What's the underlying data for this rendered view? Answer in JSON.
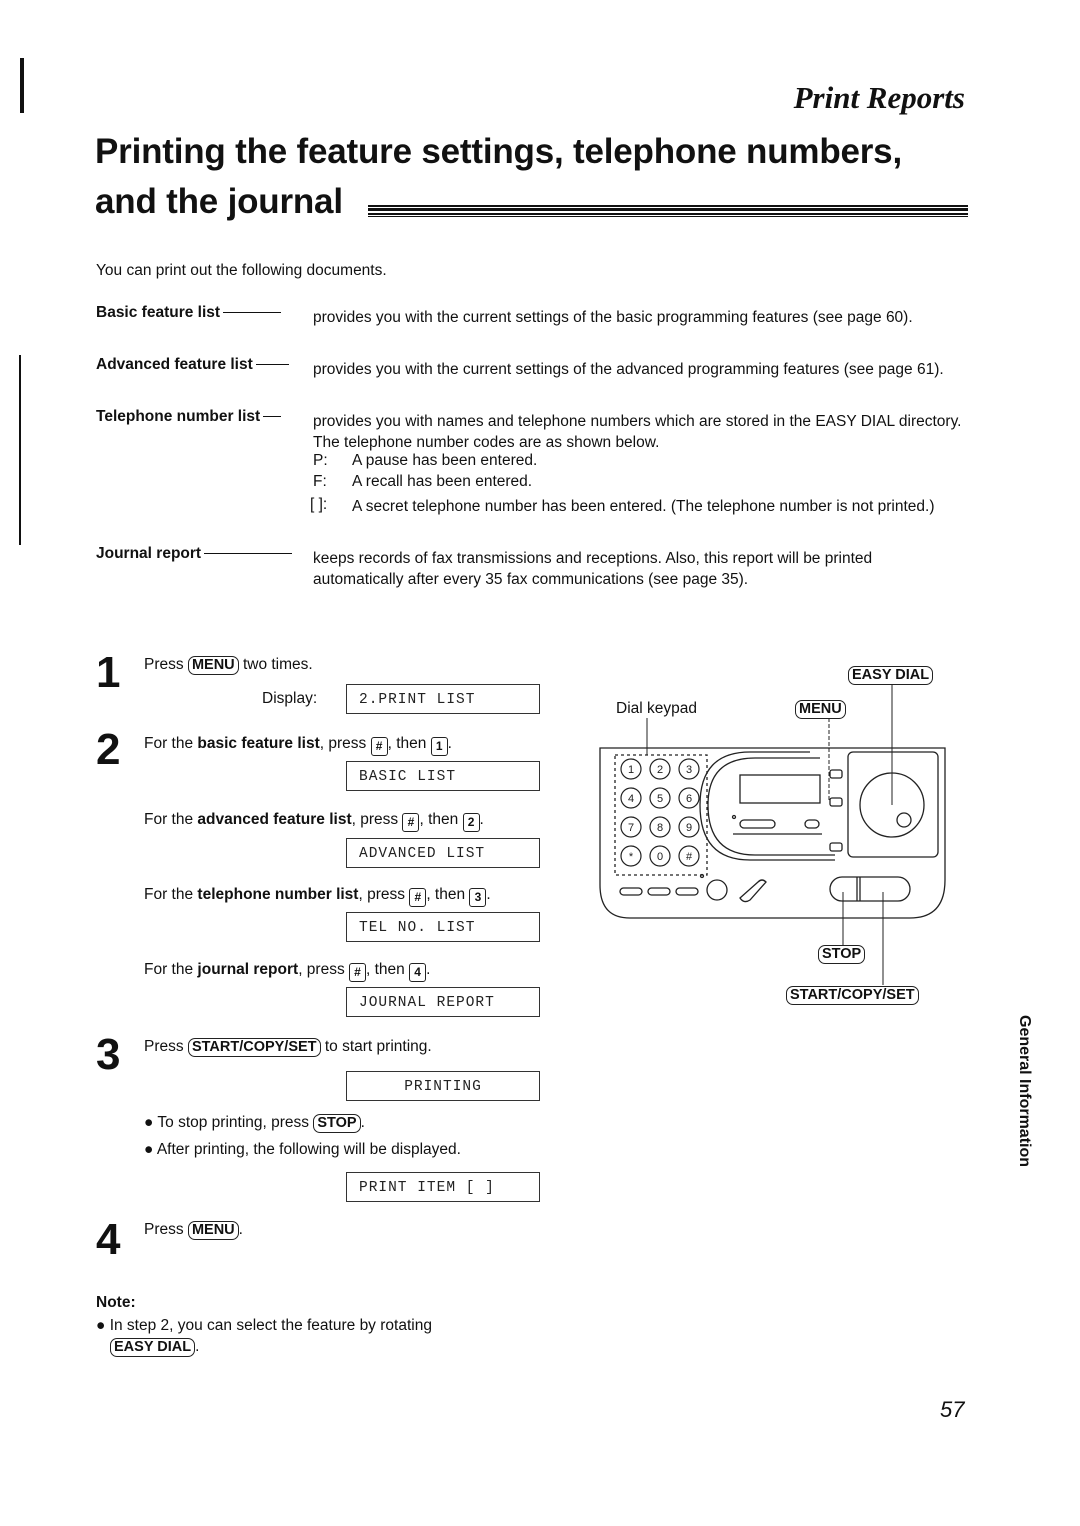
{
  "header": {
    "section_title": "Print Reports"
  },
  "title": {
    "line1": "Printing the feature settings, telephone numbers,",
    "line2": "and the journal"
  },
  "intro": "You can print out the following documents.",
  "definitions": [
    {
      "term": "Basic feature list",
      "desc": "provides you with the current settings of the basic programming features (see page 60)."
    },
    {
      "term": "Advanced feature list",
      "desc": "provides you with the current settings of the advanced programming features (see page 61)."
    },
    {
      "term": "Telephone number list",
      "desc": "provides you with names and telephone numbers which are stored in the EASY DIAL directory. The telephone number codes are as shown below."
    },
    {
      "term": "Journal report",
      "desc": "keeps records of fax transmissions and receptions. Also, this report will be printed automatically after every 35 fax communications (see page 35)."
    }
  ],
  "codes": [
    {
      "code": "P:",
      "desc": "A pause has been entered."
    },
    {
      "code": "F:",
      "desc": "A recall has been entered."
    },
    {
      "code": "[  ]:",
      "desc": "A secret telephone number has been entered. (The telephone number is not printed.)"
    }
  ],
  "steps": {
    "s1": {
      "num": "1",
      "pre": "Press",
      "key": "MENU",
      "post": "two times.",
      "display_label": "Display:",
      "display": "2.PRINT LIST"
    },
    "s2": {
      "num": "2",
      "items": [
        {
          "pre": "For the ",
          "bold": "basic feature list",
          "mid": ", press ",
          "k1": "#",
          "then": ", then ",
          "k2": "1",
          "end": ".",
          "display": "BASIC LIST"
        },
        {
          "pre": "For the ",
          "bold": "advanced feature list",
          "mid": ", press ",
          "k1": "#",
          "then": ", then ",
          "k2": "2",
          "end": ".",
          "display": "ADVANCED LIST"
        },
        {
          "pre": "For the ",
          "bold": "telephone number list",
          "mid": ", press ",
          "k1": "#",
          "then": ", then ",
          "k2": "3",
          "end": ".",
          "display": "TEL NO. LIST"
        },
        {
          "pre": "For the ",
          "bold": "journal report",
          "mid": ", press ",
          "k1": "#",
          "then": ", then ",
          "k2": "4",
          "end": ".",
          "display": "JOURNAL REPORT"
        }
      ]
    },
    "s3": {
      "num": "3",
      "pre": "Press",
      "key": "START/COPY/SET",
      "post": "to start printing.",
      "display": "PRINTING",
      "bullet1_pre": "To stop printing, press",
      "bullet1_key": "STOP",
      "bullet1_end": ".",
      "bullet2": "After printing, the following will be displayed.",
      "display2": "PRINT ITEM [ ]"
    },
    "s4": {
      "num": "4",
      "pre": "Press",
      "key": "MENU",
      "end": "."
    }
  },
  "note": {
    "heading": "Note:",
    "text": "In step 2, you can select the feature by rotating",
    "key": "EASY DIAL",
    "end": "."
  },
  "figure": {
    "dial_keypad_label": "Dial keypad",
    "easy_dial_label": "EASY DIAL",
    "menu_label": "MENU",
    "stop_label": "STOP",
    "start_label": "START/COPY/SET",
    "keypad": [
      "1",
      "2",
      "3",
      "4",
      "5",
      "6",
      "7",
      "8",
      "9",
      "*",
      "0",
      "#"
    ]
  },
  "side_tab": "General Information",
  "page_number": "57"
}
